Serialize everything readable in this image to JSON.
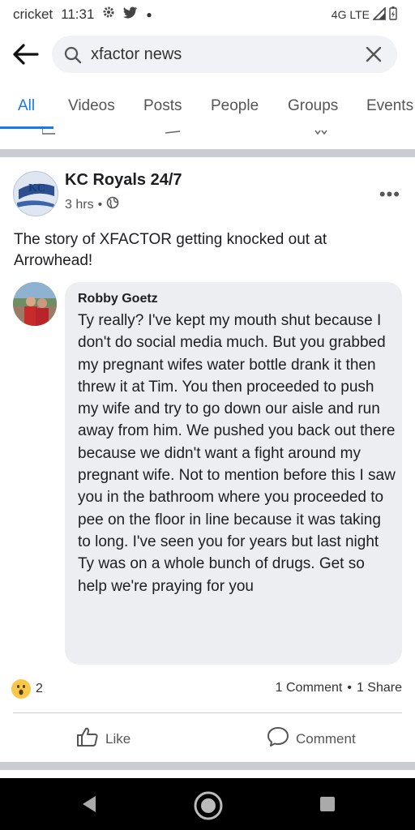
{
  "status_bar": {
    "carrier": "cricket",
    "time": "11:31",
    "network": "4G LTE"
  },
  "search": {
    "query": "xfactor news"
  },
  "tabs": [
    {
      "label": "All",
      "active": true
    },
    {
      "label": "Videos"
    },
    {
      "label": "Posts"
    },
    {
      "label": "People"
    },
    {
      "label": "Groups"
    },
    {
      "label": "Events"
    }
  ],
  "post": {
    "page_name": "KC Royals 24/7",
    "time": "3 hrs",
    "text": "The story of XFACTOR getting knocked out at Arrowhead!"
  },
  "comment": {
    "author": "Robby Goetz",
    "text": "Ty really? I've kept my mouth shut because I don't do social media much. But you grabbed my pregnant wifes water bottle drank it then threw it at Tim. You then proceeded to push my wife and try to go down our aisle and run away from him. We pushed you back out there because we didn't want a fight around my pregnant wife. Not to mention before this I saw you in the bathroom where you proceeded to pee on the floor in line because it was taking to long. I've seen you for years but last night Ty was on a whole bunch of drugs. Get so help we're praying for you"
  },
  "reactions": {
    "count": "2",
    "icon": "wow-icon"
  },
  "engagement": {
    "comments": "1 Comment",
    "shares": "1 Share",
    "separator": "•"
  },
  "actions": {
    "like": "Like",
    "comment": "Comment"
  },
  "colors": {
    "accent": "#1877f2",
    "bubble": "#eceef2",
    "divider": "#c9ccd1"
  }
}
